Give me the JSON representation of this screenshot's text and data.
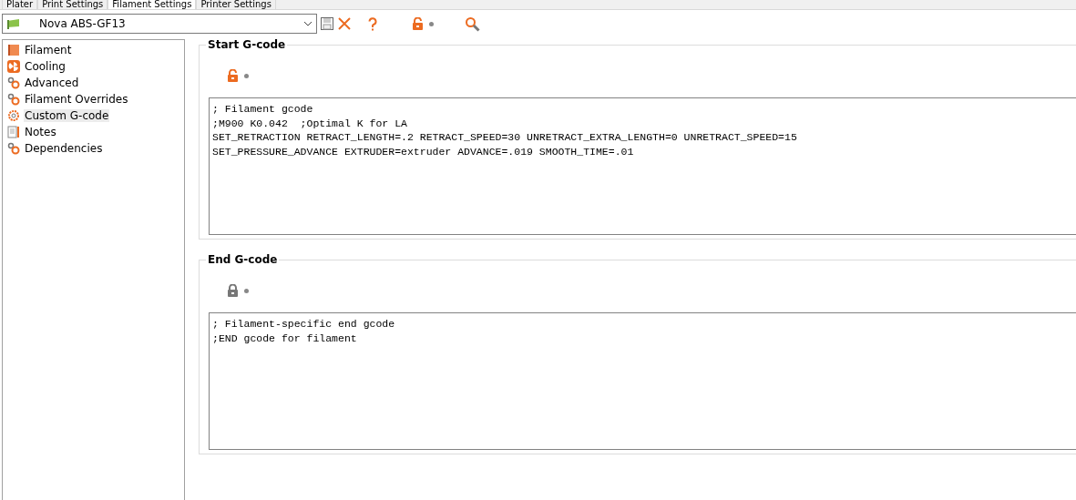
{
  "tabs": [
    {
      "label": "Plater",
      "selected": false
    },
    {
      "label": "Print Settings",
      "selected": false
    },
    {
      "label": "Filament Settings",
      "selected": true
    },
    {
      "label": "Printer Settings",
      "selected": false
    }
  ],
  "preset": {
    "name": "Nova ABS-GF13",
    "locked": false
  },
  "sidebar": {
    "items": [
      {
        "label": "Filament",
        "kind": "filament",
        "selected": false
      },
      {
        "label": "Cooling",
        "kind": "cooling",
        "selected": false
      },
      {
        "label": "Advanced",
        "kind": "gears",
        "selected": false
      },
      {
        "label": "Filament Overrides",
        "kind": "gears",
        "selected": false
      },
      {
        "label": "Custom G-code",
        "kind": "gear",
        "selected": true
      },
      {
        "label": "Notes",
        "kind": "notes",
        "selected": false
      },
      {
        "label": "Dependencies",
        "kind": "gears",
        "selected": false
      }
    ]
  },
  "sections": [
    {
      "title": "Start G-code",
      "locked": false,
      "lines": [
        "; Filament gcode",
        ";M900 K0.042  ;Optimal K for LA",
        "SET_RETRACTION RETRACT_LENGTH=.2 RETRACT_SPEED=30 UNRETRACT_EXTRA_LENGTH=0 UNRETRACT_SPEED=15",
        "SET_PRESSURE_ADVANCE EXTRUDER=extruder ADVANCE=.019 SMOOTH_TIME=.01"
      ]
    },
    {
      "title": "End G-code",
      "locked": true,
      "lines": [
        "; Filament-specific end gcode",
        ";END gcode for filament"
      ]
    }
  ]
}
